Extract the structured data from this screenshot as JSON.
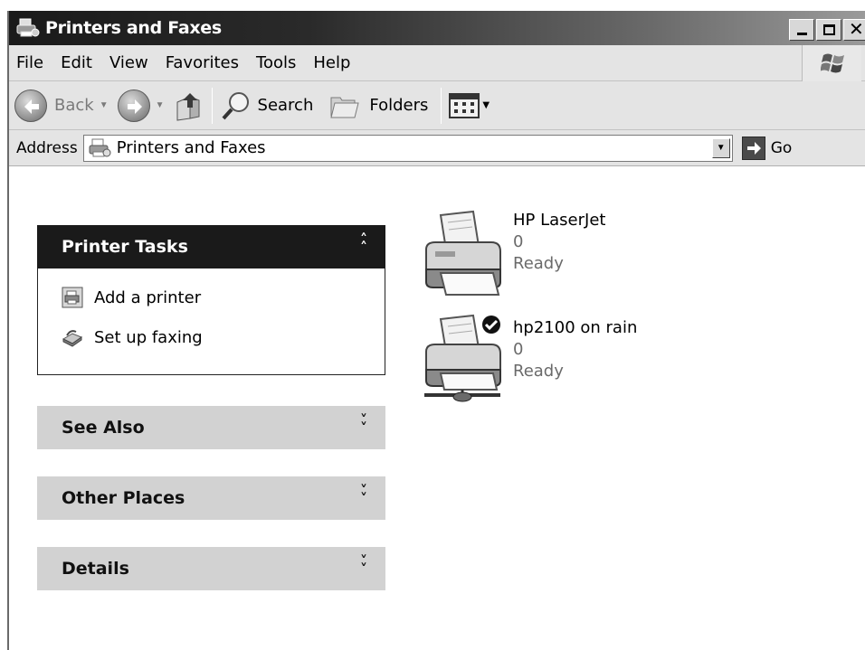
{
  "window": {
    "title": "Printers and Faxes"
  },
  "menu": [
    "File",
    "Edit",
    "View",
    "Favorites",
    "Tools",
    "Help"
  ],
  "toolbar": {
    "back_label": "Back",
    "search_label": "Search",
    "folders_label": "Folders"
  },
  "address": {
    "label": "Address",
    "value": "Printers and Faxes",
    "go_label": "Go"
  },
  "sidebar": {
    "printer_tasks": {
      "title": "Printer Tasks",
      "items": [
        {
          "label": "Add a printer",
          "icon": "add-printer-icon"
        },
        {
          "label": "Set up faxing",
          "icon": "fax-icon"
        }
      ]
    },
    "see_also": {
      "title": "See Also"
    },
    "other_places": {
      "title": "Other Places"
    },
    "details": {
      "title": "Details"
    }
  },
  "printers": [
    {
      "name": "HP LaserJet",
      "documents": "0",
      "status": "Ready",
      "default": false,
      "network": false
    },
    {
      "name": "hp2100 on rain",
      "documents": "0",
      "status": "Ready",
      "default": true,
      "network": true
    }
  ]
}
